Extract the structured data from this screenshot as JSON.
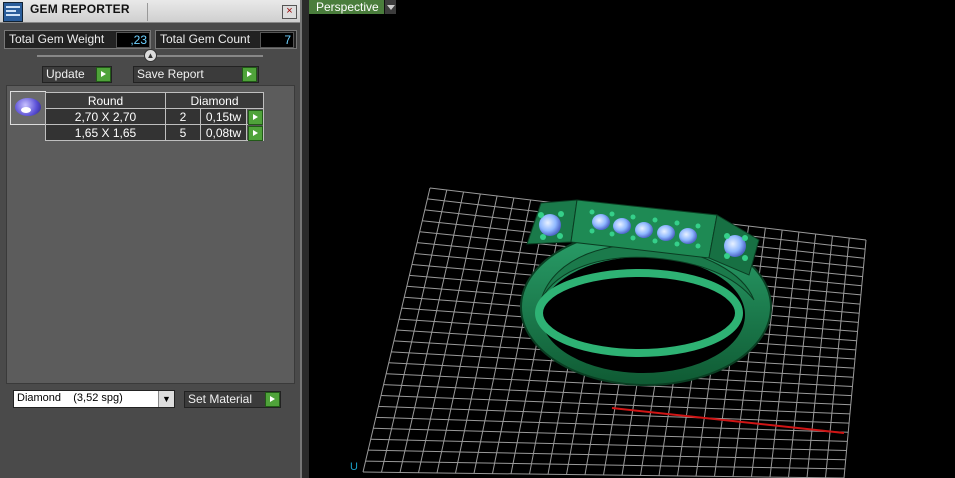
{
  "window": {
    "title": "GEM REPORTER",
    "close_label": "×"
  },
  "summary": {
    "weight_label": "Total Gem Weight",
    "weight_value": ",23",
    "count_label": "Total Gem Count",
    "count_value": "7"
  },
  "actions": {
    "update_label": "Update",
    "save_label": "Save Report"
  },
  "gem_table": {
    "shape": "Round",
    "material": "Diamond",
    "rows": [
      {
        "size": "2,70 X 2,70",
        "qty": "2",
        "weight": "0,15tw"
      },
      {
        "size": "1,65 X 1,65",
        "qty": "5",
        "weight": "0,08tw"
      }
    ]
  },
  "material_select": {
    "value": "Diamond",
    "spg": "(3,52 spg)"
  },
  "set_material_label": "Set Material",
  "viewport": {
    "view_label": "Perspective",
    "axis_label": "U"
  },
  "colors": {
    "ring": "#1c7a4c",
    "stone": "#8fb8ff",
    "axis_x": "#d01515",
    "axis_y": "#1aa0c8",
    "grid": "#9a9a9a"
  }
}
